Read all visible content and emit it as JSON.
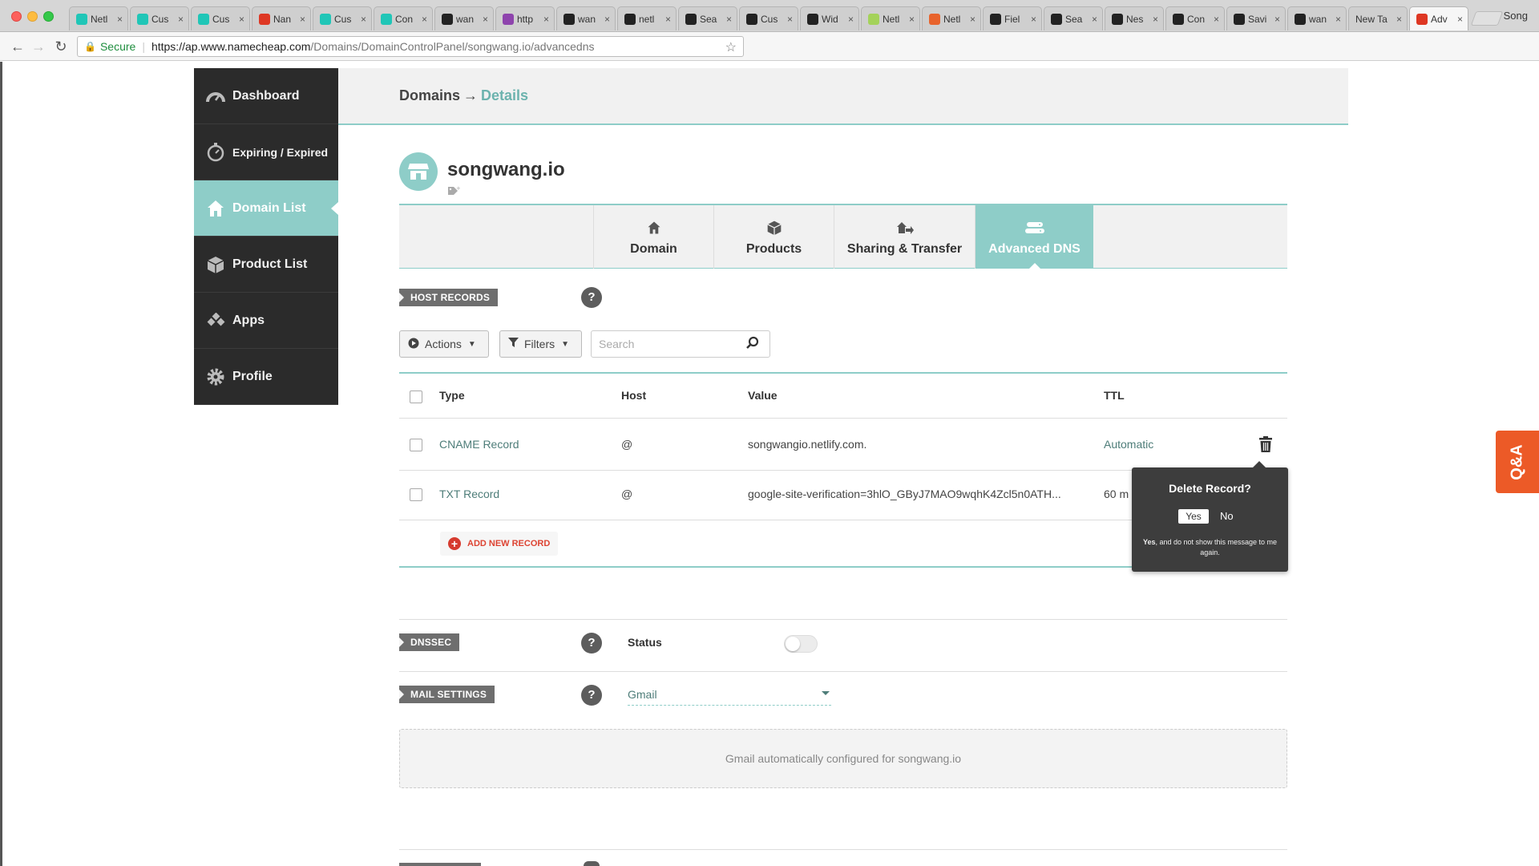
{
  "browser": {
    "tabs": [
      {
        "label": "Netl",
        "icon": "netlify-icon",
        "color": "#20c6b7"
      },
      {
        "label": "Cus",
        "icon": "netlify-icon",
        "color": "#20c6b7"
      },
      {
        "label": "Cus",
        "icon": "netlify-icon",
        "color": "#20c6b7"
      },
      {
        "label": "Nan",
        "icon": "namecheap-icon",
        "color": "#de3723"
      },
      {
        "label": "Cus",
        "icon": "netlify-icon",
        "color": "#20c6b7"
      },
      {
        "label": "Con",
        "icon": "netlify-icon",
        "color": "#20c6b7"
      },
      {
        "label": "wan",
        "icon": "github-icon",
        "color": "#222222"
      },
      {
        "label": "http",
        "icon": "s-icon",
        "color": "#8e44ad"
      },
      {
        "label": "wan",
        "icon": "github-icon",
        "color": "#222222"
      },
      {
        "label": "netl",
        "icon": "github-icon",
        "color": "#222222"
      },
      {
        "label": "Sea",
        "icon": "github-icon",
        "color": "#222222"
      },
      {
        "label": "Cus",
        "icon": "github-icon",
        "color": "#222222"
      },
      {
        "label": "Wid",
        "icon": "github-icon",
        "color": "#222222"
      },
      {
        "label": "Netl",
        "icon": "netlify-icon",
        "color": "#a4d25a"
      },
      {
        "label": "Netl",
        "icon": "e-icon",
        "color": "#e8632c"
      },
      {
        "label": "Fiel",
        "icon": "github-icon",
        "color": "#222222"
      },
      {
        "label": "Sea",
        "icon": "github-icon",
        "color": "#222222"
      },
      {
        "label": "Nes",
        "icon": "github-icon",
        "color": "#222222"
      },
      {
        "label": "Con",
        "icon": "github-icon",
        "color": "#222222"
      },
      {
        "label": "Savi",
        "icon": "github-icon",
        "color": "#222222"
      },
      {
        "label": "wan",
        "icon": "github-icon",
        "color": "#222222"
      },
      {
        "label": "New Ta",
        "icon": "",
        "color": ""
      },
      {
        "label": "Adv",
        "icon": "namecheap-icon",
        "color": "#de3723"
      }
    ],
    "profile": "Song",
    "secure_label": "Secure",
    "url_scheme": "https://",
    "url_host": "ap.www.namecheap.com",
    "url_path": "/Domains/DomainControlPanel/songwang.io/advancedns"
  },
  "sidebar": {
    "items": [
      {
        "label": "Dashboard",
        "icon": "speedometer-icon"
      },
      {
        "label": "Expiring / Expired",
        "icon": "stopwatch-icon"
      },
      {
        "label": "Domain List",
        "icon": "home-icon"
      },
      {
        "label": "Product List",
        "icon": "box-icon"
      },
      {
        "label": "Apps",
        "icon": "apps-icon"
      },
      {
        "label": "Profile",
        "icon": "gear-icon"
      }
    ]
  },
  "header": {
    "crumb_root": "Domains",
    "arrow": "→",
    "crumb_current": "Details"
  },
  "domain": {
    "name": "songwang.io"
  },
  "product_tabs": [
    "Domain",
    "Products",
    "Sharing & Transfer",
    "Advanced DNS"
  ],
  "host_records": {
    "section_label": "HOST RECORDS",
    "actions_label": "Actions",
    "filters_label": "Filters",
    "search_placeholder": "Search",
    "columns": {
      "type": "Type",
      "host": "Host",
      "value": "Value",
      "ttl": "TTL"
    },
    "rows": [
      {
        "type": "CNAME Record",
        "host": "@",
        "value": "songwangio.netlify.com.",
        "ttl": "Automatic"
      },
      {
        "type": "TXT Record",
        "host": "@",
        "value": "google-site-verification=3hlO_GByJ7MAO9wqhK4Zcl5n0ATH...",
        "ttl": "60 m"
      }
    ],
    "add_label": "ADD NEW RECORD"
  },
  "delete_popover": {
    "title": "Delete Record?",
    "yes": "Yes",
    "no": "No",
    "note_bold": "Yes",
    "note_rest": ", and do not show this message to me again."
  },
  "dnssec": {
    "section_label": "DNSSEC",
    "status_label": "Status",
    "enabled": false
  },
  "mail": {
    "section_label": "MAIL SETTINGS",
    "selected": "Gmail",
    "info": "Gmail automatically configured for songwang.io"
  },
  "help_symbol": "?",
  "qa_label": "Q&A",
  "colors": {
    "accent": "#8ecdc8",
    "sidebar_bg": "#2b2b2b",
    "qa": "#ec5a27",
    "danger": "#d63b2f"
  }
}
